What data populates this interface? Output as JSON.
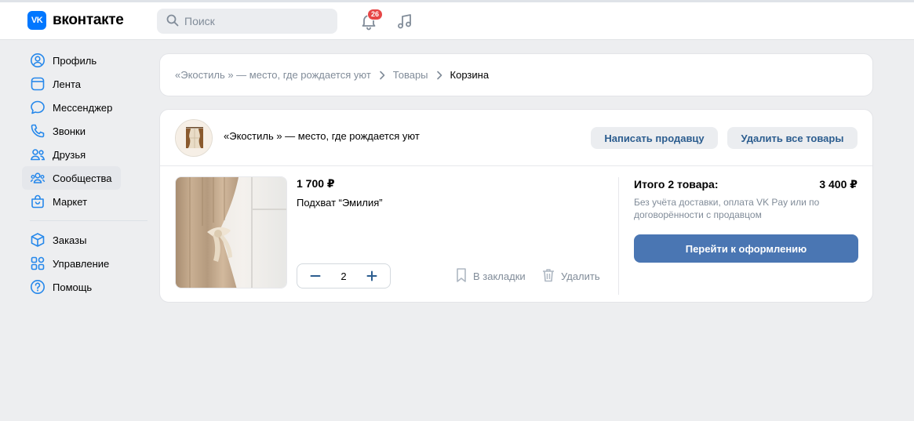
{
  "header": {
    "logo_text": "вконтакте",
    "logo_mark": "VK",
    "search_placeholder": "Поиск",
    "notifications_count": "26",
    "icons": [
      "search-icon",
      "bell-icon",
      "music-icon"
    ]
  },
  "sidebar": {
    "items": [
      {
        "label": "Профиль",
        "icon": "profile-icon"
      },
      {
        "label": "Лента",
        "icon": "feed-icon"
      },
      {
        "label": "Мессенджер",
        "icon": "messenger-icon"
      },
      {
        "label": "Звонки",
        "icon": "phone-icon"
      },
      {
        "label": "Друзья",
        "icon": "friends-icon"
      },
      {
        "label": "Сообщества",
        "icon": "communities-icon"
      },
      {
        "label": "Маркет",
        "icon": "market-icon"
      },
      {
        "label": "Заказы",
        "icon": "box-icon"
      },
      {
        "label": "Управление",
        "icon": "grid-icon"
      },
      {
        "label": "Помощь",
        "icon": "help-icon"
      }
    ]
  },
  "breadcrumbs": {
    "items": [
      "«Экостиль » — место, где рождается уют",
      "Товары",
      "Корзина"
    ]
  },
  "cart": {
    "shop_name": "«Экостиль » — место, где рождается уют",
    "write_seller_label": "Написать продавцу",
    "delete_all_label": "Удалить все товары",
    "item": {
      "price": "1 700 ₽",
      "name": "Подхват “Эмилия”",
      "quantity": "2",
      "bookmark_label": "В закладки",
      "delete_label": "Удалить"
    },
    "summary": {
      "total_label": "Итого 2 товара:",
      "total_value": "3 400 ₽",
      "note": "Без учёта доставки, оплата VK Pay или по договорённости с продавцом",
      "checkout_label": "Перейти к оформлению"
    }
  },
  "colors": {
    "accent": "#0077ff",
    "primary_button": "#4a76b3",
    "secondary_text": "#818c99",
    "background": "#edeef0",
    "badge": "#e64646"
  }
}
